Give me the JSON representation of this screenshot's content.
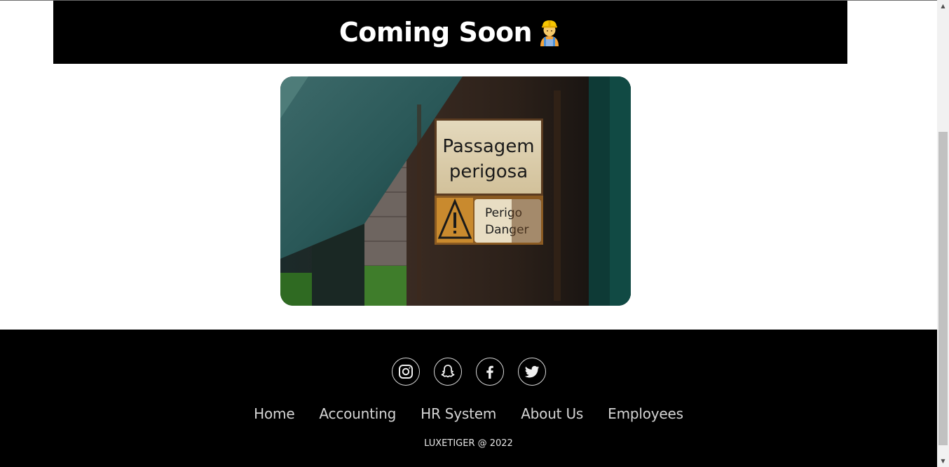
{
  "header": {
    "title": "Coming Soon",
    "title_emoji_icon": "construction-worker-icon"
  },
  "hero_image": {
    "sign_line1": "Passagem",
    "sign_line2": "perigosa",
    "sign_small_line1": "Perigo",
    "sign_small_line2": "Danger"
  },
  "footer": {
    "socials": [
      {
        "icon": "instagram-icon"
      },
      {
        "icon": "snapchat-icon"
      },
      {
        "icon": "facebook-icon"
      },
      {
        "icon": "twitter-icon"
      }
    ],
    "nav": [
      "Home",
      "Accounting",
      "HR System",
      "About Us",
      "Employees"
    ],
    "copyright": "LUXETIGER @ 2022"
  },
  "colors": {
    "header_bg": "#000000",
    "footer_bg": "#000000",
    "title_text": "#ffffff",
    "nav_text": "#d4d4d4"
  }
}
